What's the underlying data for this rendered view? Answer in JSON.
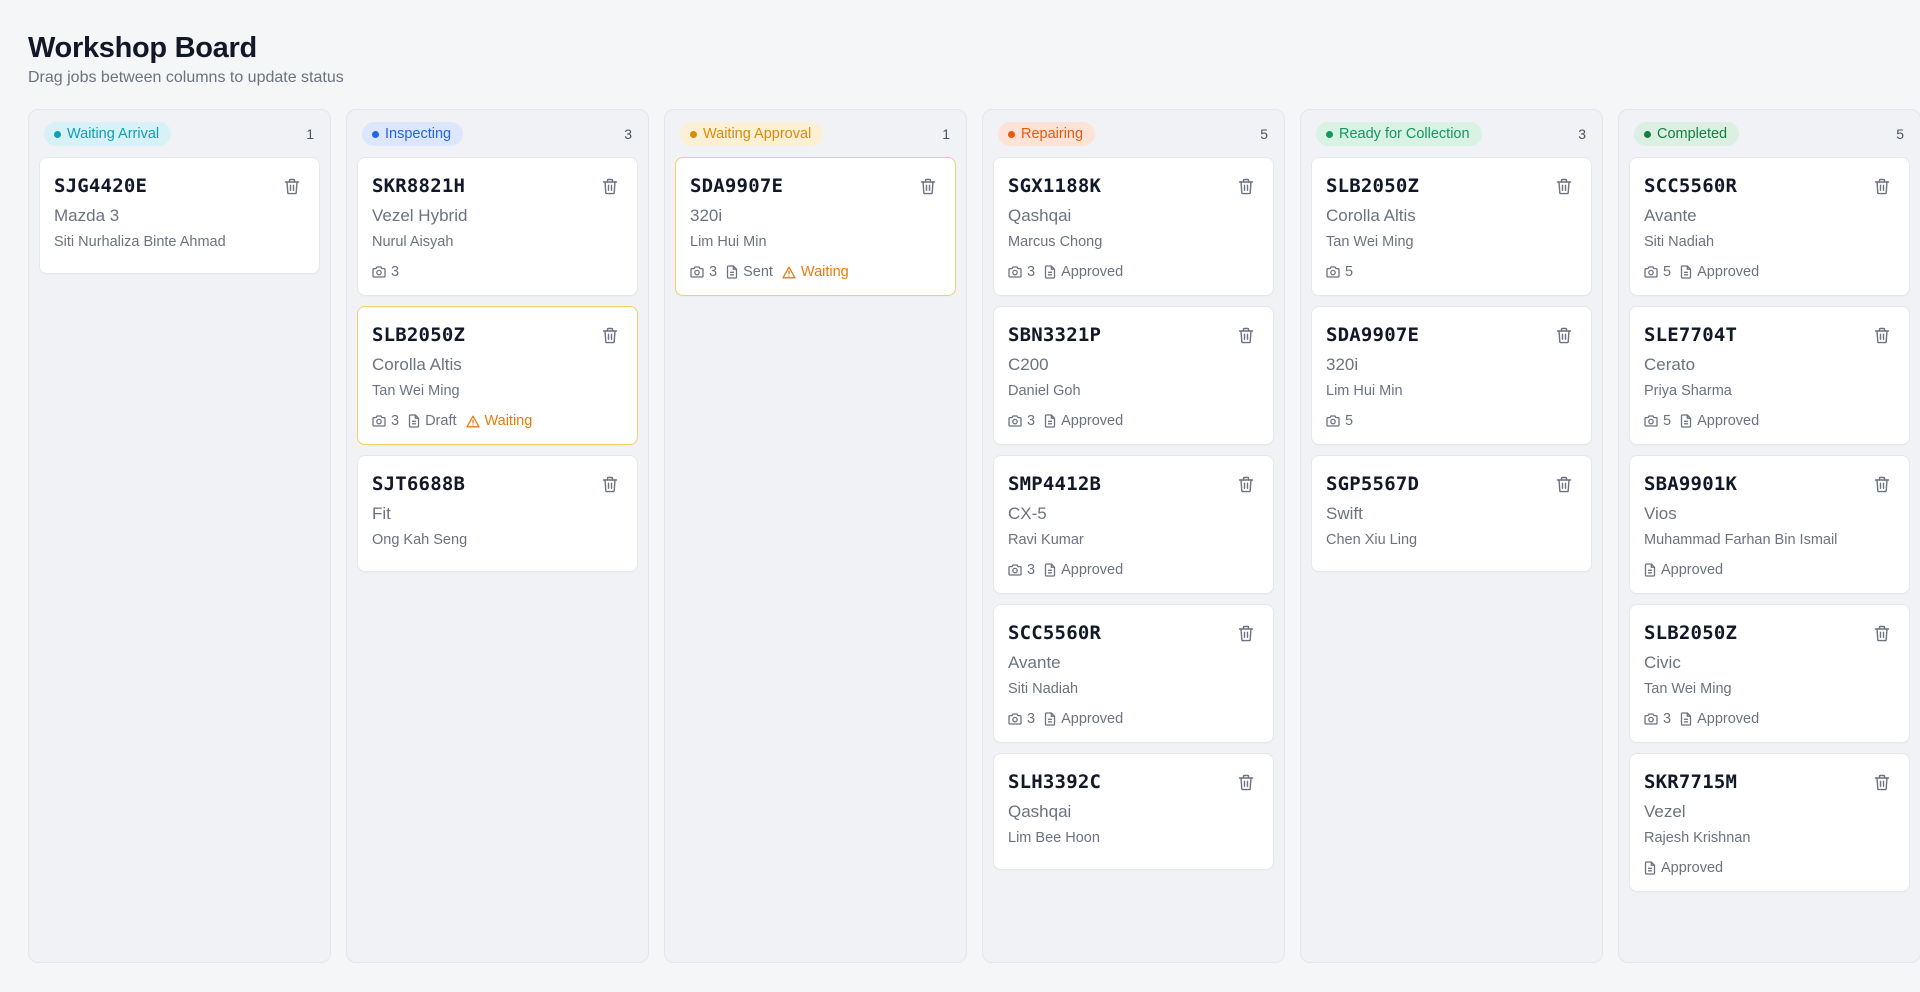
{
  "header": {
    "title": "Workshop Board",
    "subtitle": "Drag jobs between columns to update status"
  },
  "columns": [
    {
      "id": "waiting-arrival",
      "label": "Waiting Arrival",
      "count": "1",
      "color": "#0e9fb6",
      "bg": "#d8f1f6",
      "cards": [
        {
          "plate": "SJG4420E",
          "model": "Mazda 3",
          "owner": "Siti Nurhaliza Binte Ahmad",
          "photos": null,
          "quote": null,
          "warning": null
        }
      ]
    },
    {
      "id": "inspecting",
      "label": "Inspecting",
      "count": "3",
      "color": "#2563eb",
      "bg": "#dce7fd",
      "cards": [
        {
          "plate": "SKR8821H",
          "model": "Vezel Hybrid",
          "owner": "Nurul Aisyah",
          "photos": "3",
          "quote": null,
          "warning": null
        },
        {
          "plate": "SLB2050Z",
          "model": "Corolla Altis",
          "owner": "Tan Wei Ming",
          "photos": "3",
          "quote": "Draft",
          "warning": "Waiting"
        },
        {
          "plate": "SJT6688B",
          "model": "Fit",
          "owner": "Ong Kah Seng",
          "photos": null,
          "quote": null,
          "warning": null
        }
      ]
    },
    {
      "id": "waiting-approval",
      "label": "Waiting Approval",
      "count": "1",
      "color": "#d68d0b",
      "bg": "#fbefd6",
      "cards": [
        {
          "plate": "SDA9907E",
          "model": "320i",
          "owner": "Lim Hui Min",
          "photos": "3",
          "quote": "Sent",
          "warning": "Waiting"
        }
      ]
    },
    {
      "id": "repairing",
      "label": "Repairing",
      "count": "5",
      "color": "#e8590c",
      "bg": "#fde3d7",
      "cards": [
        {
          "plate": "SGX1188K",
          "model": "Qashqai",
          "owner": "Marcus Chong",
          "photos": "3",
          "quote": "Approved",
          "warning": null
        },
        {
          "plate": "SBN3321P",
          "model": "C200",
          "owner": "Daniel Goh",
          "photos": "3",
          "quote": "Approved",
          "warning": null
        },
        {
          "plate": "SMP4412B",
          "model": "CX-5",
          "owner": "Ravi Kumar",
          "photos": "3",
          "quote": "Approved",
          "warning": null
        },
        {
          "plate": "SCC5560R",
          "model": "Avante",
          "owner": "Siti Nadiah",
          "photos": "3",
          "quote": "Approved",
          "warning": null
        },
        {
          "plate": "SLH3392C",
          "model": "Qashqai",
          "owner": "Lim Bee Hoon",
          "photos": null,
          "quote": null,
          "warning": null
        }
      ]
    },
    {
      "id": "ready-for-collection",
      "label": "Ready for Collection",
      "count": "3",
      "color": "#109a5c",
      "bg": "#d9f2e4",
      "cards": [
        {
          "plate": "SLB2050Z",
          "model": "Corolla Altis",
          "owner": "Tan Wei Ming",
          "photos": "5",
          "quote": null,
          "warning": null
        },
        {
          "plate": "SDA9907E",
          "model": "320i",
          "owner": "Lim Hui Min",
          "photos": "5",
          "quote": null,
          "warning": null
        },
        {
          "plate": "SGP5567D",
          "model": "Swift",
          "owner": "Chen Xiu Ling",
          "photos": null,
          "quote": null,
          "warning": null
        }
      ]
    },
    {
      "id": "completed",
      "label": "Completed",
      "count": "5",
      "color": "#15803d",
      "bg": "#dbf0e2",
      "cards": [
        {
          "plate": "SCC5560R",
          "model": "Avante",
          "owner": "Siti Nadiah",
          "photos": "5",
          "quote": "Approved",
          "warning": null
        },
        {
          "plate": "SLE7704T",
          "model": "Cerato",
          "owner": "Priya Sharma",
          "photos": "5",
          "quote": "Approved",
          "warning": null
        },
        {
          "plate": "SBA9901K",
          "model": "Vios",
          "owner": "Muhammad Farhan Bin Ismail",
          "photos": null,
          "quote": "Approved",
          "warning": null
        },
        {
          "plate": "SLB2050Z",
          "model": "Civic",
          "owner": "Tan Wei Ming",
          "photos": "3",
          "quote": "Approved",
          "warning": null
        },
        {
          "plate": "SKR7715M",
          "model": "Vezel",
          "owner": "Rajesh Krishnan",
          "photos": null,
          "quote": "Approved",
          "warning": null
        }
      ]
    }
  ],
  "icons": {
    "delete": "trash-icon",
    "photos": "camera-icon",
    "quote": "document-icon",
    "warning": "warning-triangle-icon"
  }
}
